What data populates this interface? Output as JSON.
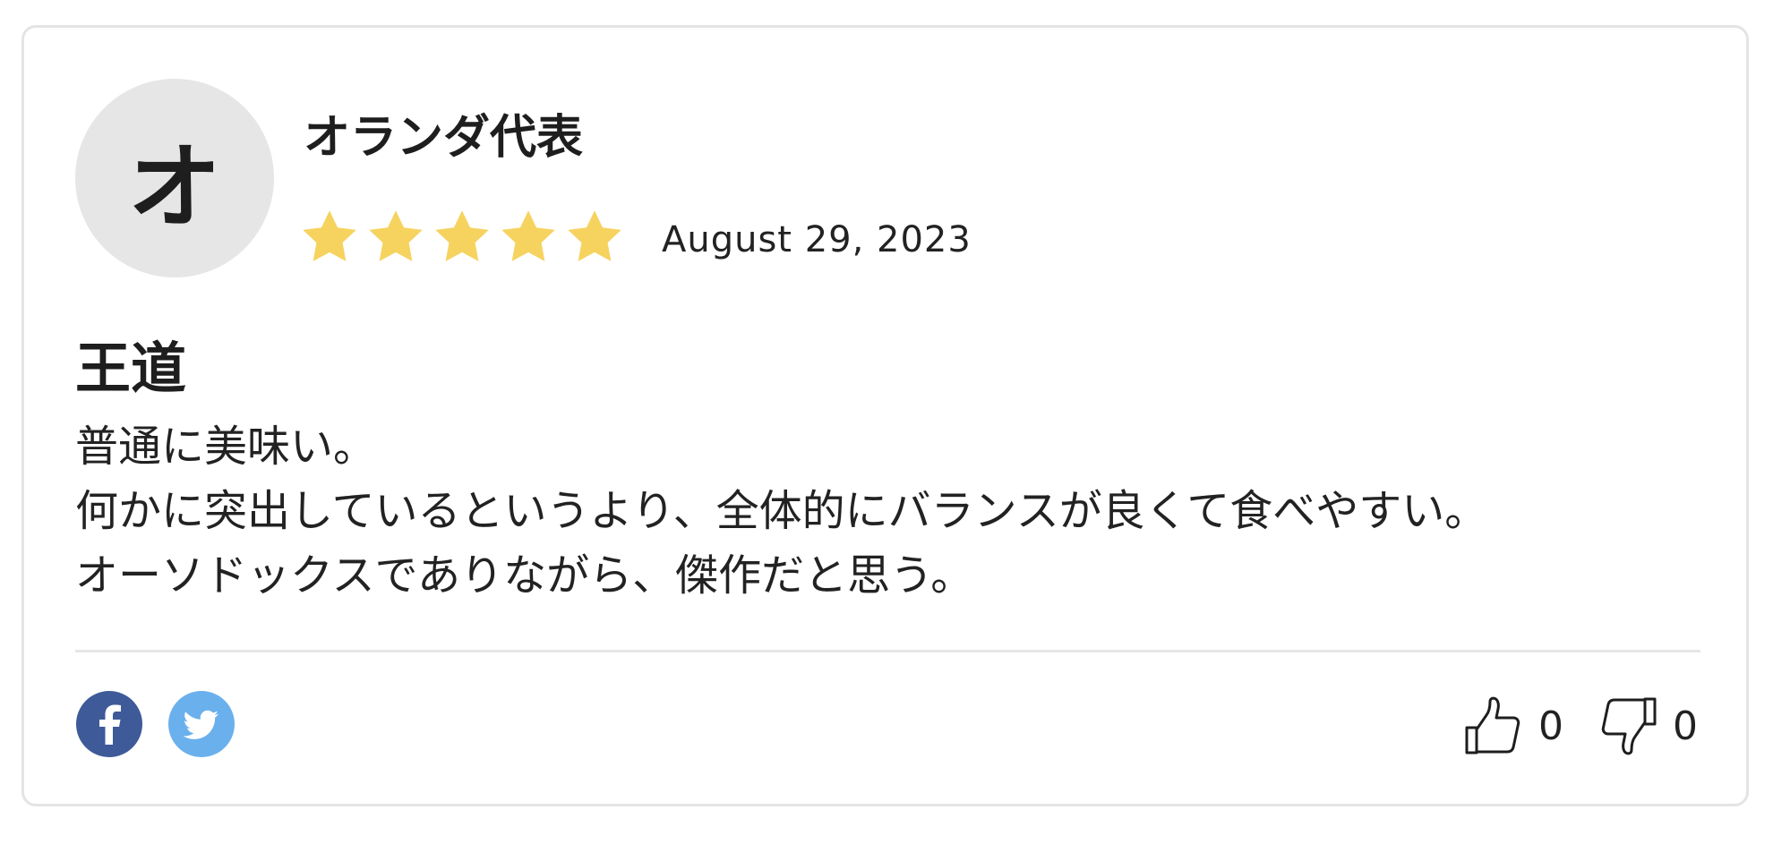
{
  "review": {
    "avatar_initial": "オ",
    "username": "オランダ代表",
    "rating": 5,
    "rating_max": 5,
    "star_color": "#f6d35f",
    "date": "August 29, 2023",
    "title": "王道",
    "body_lines": [
      "普通に美味い。",
      "何かに突出しているというより、全体的にバランスが良くて食べやすい。",
      "オーソドックスでありながら、傑作だと思う。"
    ]
  },
  "share": {
    "facebook_icon": "facebook-icon",
    "twitter_icon": "twitter-icon",
    "facebook_color": "#3e5a98",
    "twitter_color": "#6ab0ec"
  },
  "votes": {
    "up_count": "0",
    "down_count": "0",
    "up_icon": "thumbs-up-icon",
    "down_icon": "thumbs-down-icon"
  }
}
